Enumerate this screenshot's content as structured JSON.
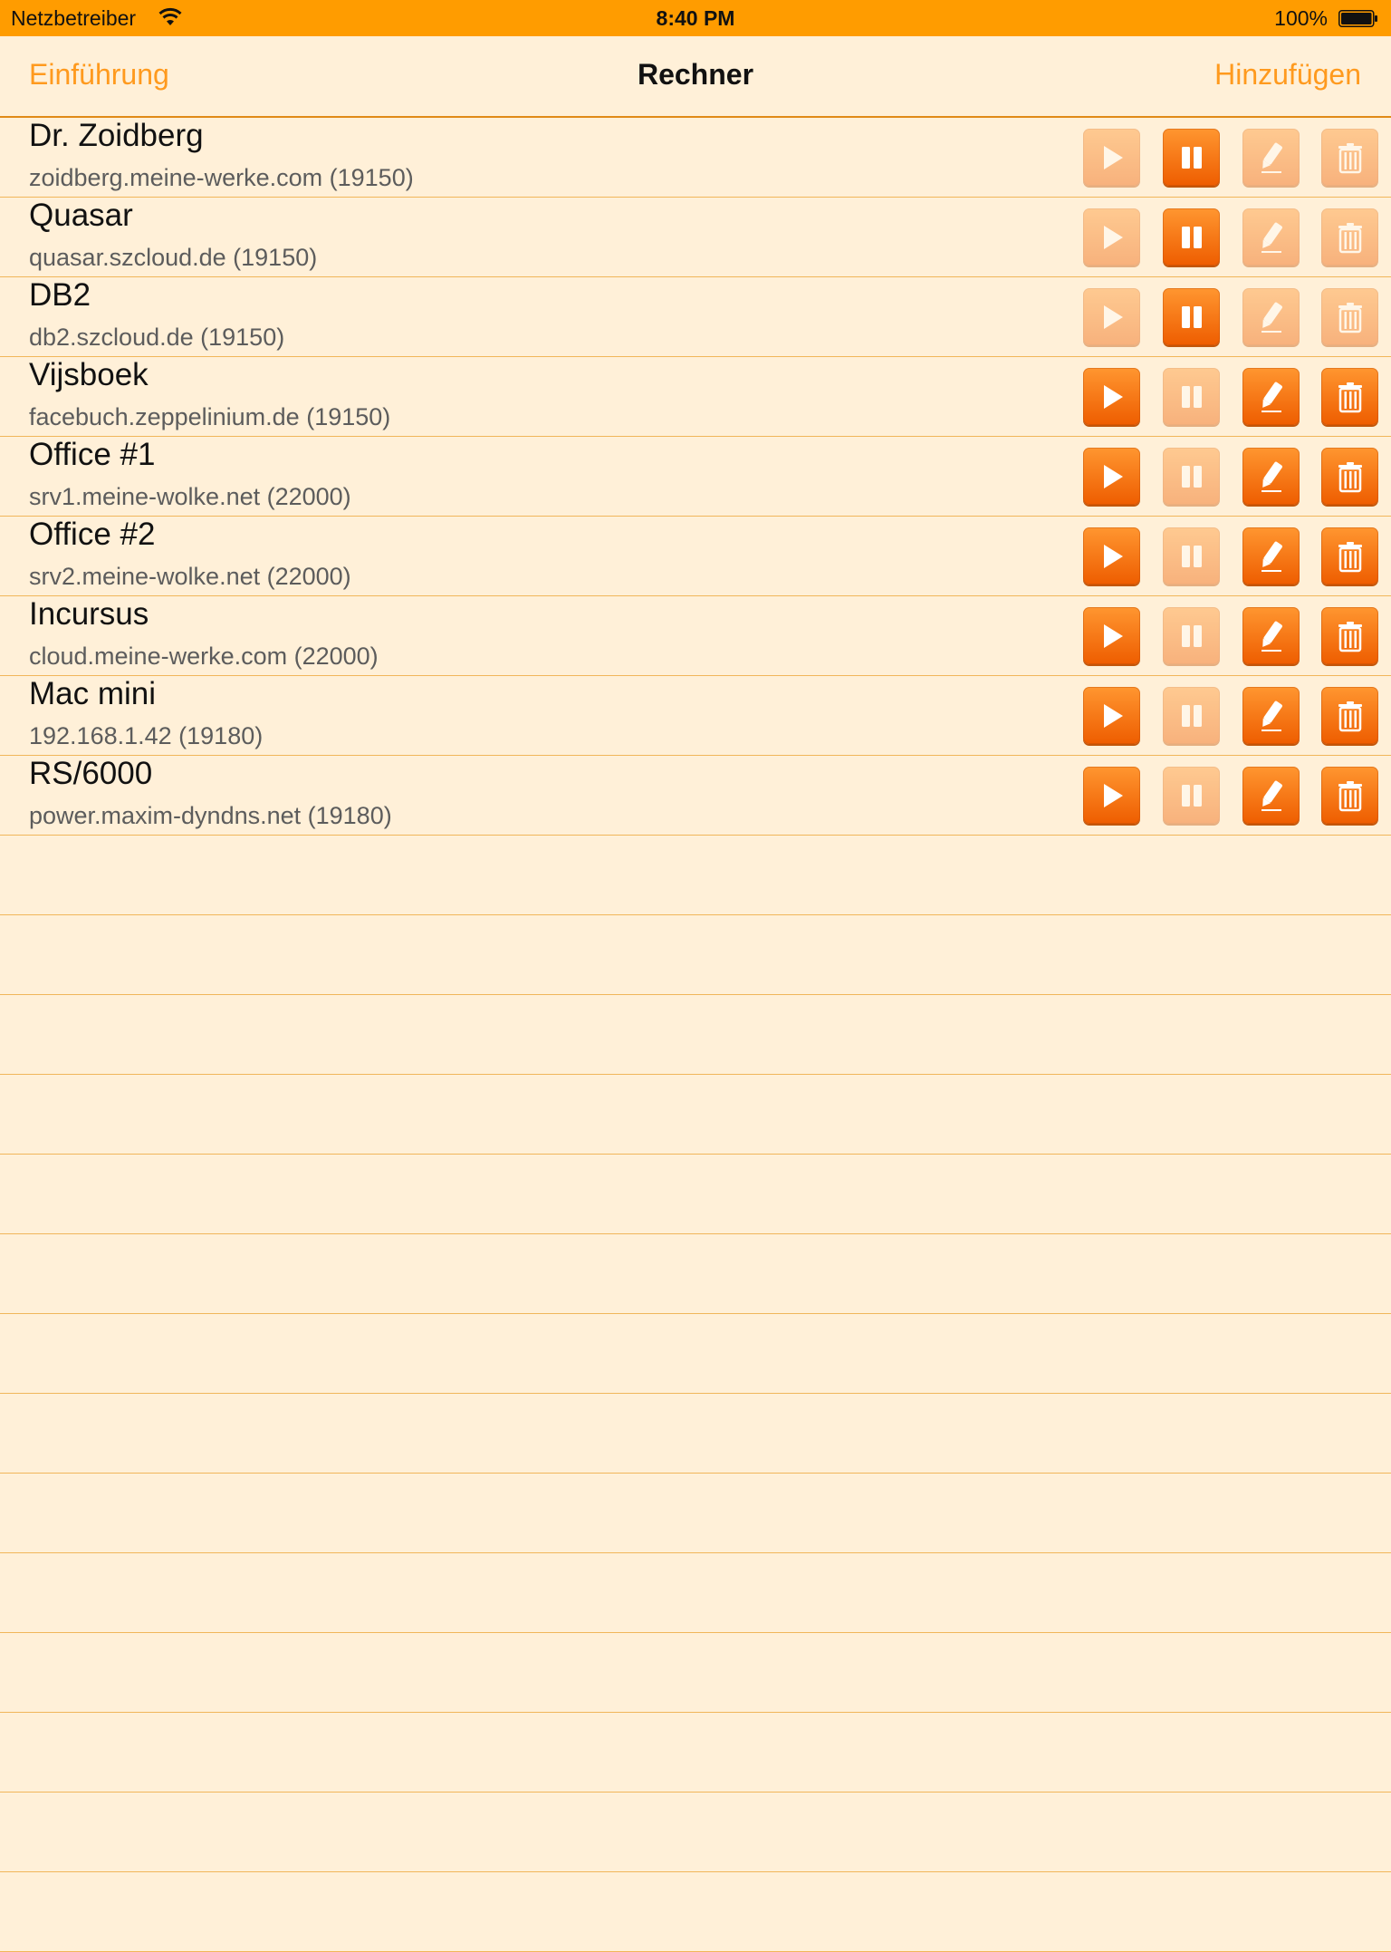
{
  "status_bar": {
    "carrier": "Netzbetreiber",
    "time": "8:40 PM",
    "battery": "100%"
  },
  "navbar": {
    "left_button": "Einführung",
    "title": "Rechner",
    "right_button": "Hinzufügen"
  },
  "colors": {
    "accent": "#ff9c00",
    "button": "#ef6a00",
    "background": "#fff0d8"
  },
  "computers": [
    {
      "name": "Dr. Zoidberg",
      "address": "zoidberg.meine-werke.com (19150)",
      "running": true
    },
    {
      "name": "Quasar",
      "address": "quasar.szcloud.de (19150)",
      "running": true
    },
    {
      "name": "DB2",
      "address": "db2.szcloud.de (19150)",
      "running": true
    },
    {
      "name": "Vijsboek",
      "address": "facebuch.zeppelinium.de (19150)",
      "running": false
    },
    {
      "name": "Office #1",
      "address": "srv1.meine-wolke.net (22000)",
      "running": false
    },
    {
      "name": "Office #2",
      "address": "srv2.meine-wolke.net (22000)",
      "running": false
    },
    {
      "name": "Incursus",
      "address": "cloud.meine-werke.com (22000)",
      "running": false
    },
    {
      "name": "Mac mini",
      "address": "192.168.1.42 (19180)",
      "running": false
    },
    {
      "name": "RS/6000",
      "address": "power.maxim-dyndns.net (19180)",
      "running": false
    }
  ],
  "icons": {
    "play": "play-icon",
    "pause": "pause-icon",
    "edit": "pencil-icon",
    "delete": "trash-icon"
  }
}
